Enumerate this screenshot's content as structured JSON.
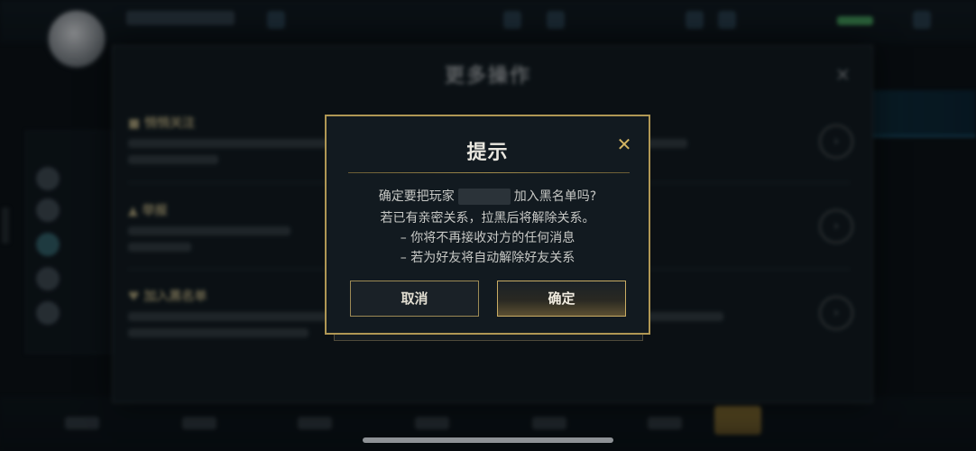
{
  "more_panel": {
    "title": "更多操作",
    "close_icon": "×",
    "rows": [
      {
        "icon": "■",
        "title": "悄悄关注"
      },
      {
        "icon": "▲",
        "title": "举报"
      },
      {
        "icon": "♥",
        "title": "加入黑名单"
      }
    ],
    "arrow_icon": "›"
  },
  "dialog": {
    "title": "提示",
    "close_icon": "✕",
    "line1_prefix": "确定要把玩家",
    "line1_suffix": "加入黑名单吗?",
    "line2": "若已有亲密关系，拉黑后将解除关系。",
    "line3": "– 你将不再接收对方的任何消息",
    "line4": "– 若为好友将自动解除好友关系",
    "cancel_label": "取消",
    "confirm_label": "确定"
  },
  "colors": {
    "accent_gold": "#b09754",
    "dialog_bg": "#121a20",
    "text_light": "#e9e7df"
  }
}
